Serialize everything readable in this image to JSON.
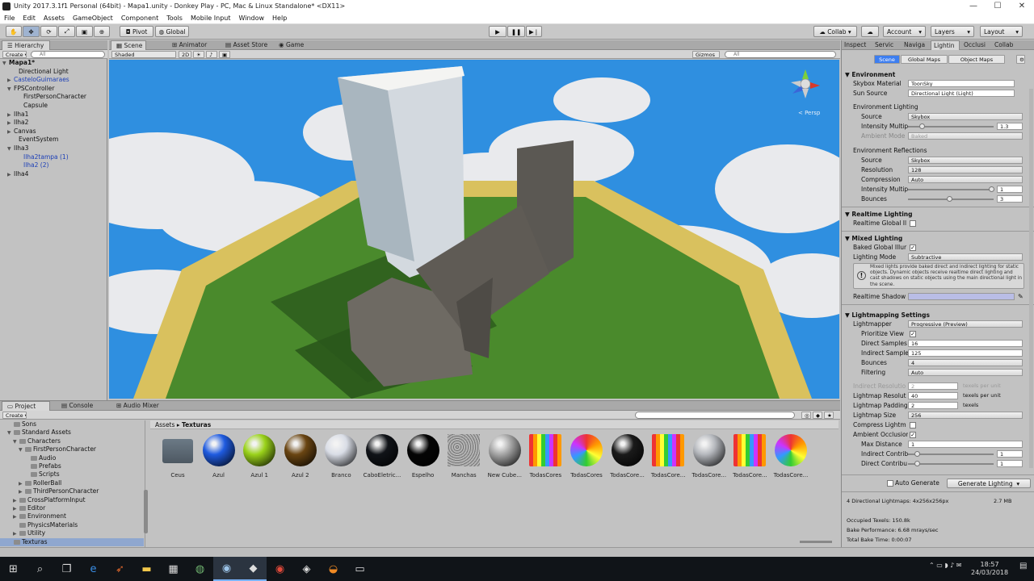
{
  "window": {
    "title": "Unity 2017.3.1f1 Personal (64bit) - Mapa1.unity - Donkey Play - PC, Mac & Linux Standalone* <DX11>",
    "minimize": "—",
    "maximize": "☐",
    "close": "✕"
  },
  "menu": [
    "File",
    "Edit",
    "Assets",
    "GameObject",
    "Component",
    "Tools",
    "Mobile Input",
    "Window",
    "Help"
  ],
  "toolbar": {
    "pivot": "Pivot",
    "global": "Global",
    "collab": "Collab ▾",
    "account": "Account",
    "layers": "Layers",
    "layout": "Layout",
    "play": "▶",
    "pause": "❚❚",
    "step": "▶❘"
  },
  "hierarchy": {
    "tab": "Hierarchy",
    "create": "Create ▾",
    "search_placeholder": "All",
    "rows": [
      {
        "label": "Mapa1*",
        "indent": 0,
        "arrow": "▼",
        "bold": true,
        "blue": false
      },
      {
        "label": "Directional Light",
        "indent": 2,
        "arrow": "",
        "bold": false,
        "blue": false
      },
      {
        "label": "CasteloGuimaraes",
        "indent": 1,
        "arrow": "▶",
        "bold": false,
        "blue": true
      },
      {
        "label": "FPSController",
        "indent": 1,
        "arrow": "▼",
        "bold": false,
        "blue": false
      },
      {
        "label": "FirstPersonCharacter",
        "indent": 3,
        "arrow": "",
        "bold": false,
        "blue": false
      },
      {
        "label": "Capsule",
        "indent": 3,
        "arrow": "",
        "bold": false,
        "blue": false
      },
      {
        "label": "Ilha1",
        "indent": 1,
        "arrow": "▶",
        "bold": false,
        "blue": false
      },
      {
        "label": "Ilha2",
        "indent": 1,
        "arrow": "▶",
        "bold": false,
        "blue": false
      },
      {
        "label": "Canvas",
        "indent": 1,
        "arrow": "▶",
        "bold": false,
        "blue": false
      },
      {
        "label": "EventSystem",
        "indent": 2,
        "arrow": "",
        "bold": false,
        "blue": false
      },
      {
        "label": "Ilha3",
        "indent": 1,
        "arrow": "▼",
        "bold": false,
        "blue": false
      },
      {
        "label": "Ilha2tampa (1)",
        "indent": 3,
        "arrow": "",
        "bold": false,
        "blue": true
      },
      {
        "label": "Ilha2 (2)",
        "indent": 3,
        "arrow": "",
        "bold": false,
        "blue": true
      },
      {
        "label": "Ilha4",
        "indent": 1,
        "arrow": "▶",
        "bold": false,
        "blue": false
      }
    ]
  },
  "scene": {
    "tabs": [
      "Scene",
      "Animator",
      "Asset Store",
      "Game"
    ],
    "shading": "Shaded",
    "mode2d": "2D",
    "gizmos": "Gizmos",
    "search_placeholder": "All",
    "persp": "< Persp"
  },
  "project": {
    "tabs": [
      "Project",
      "Console",
      "Audio Mixer"
    ],
    "create": "Create ▾",
    "breadcrumb": [
      "Assets",
      "Texturas"
    ],
    "tree": [
      {
        "label": "Sons",
        "indent": 1,
        "arrow": ""
      },
      {
        "label": "Standard Assets",
        "indent": 1,
        "arrow": "▼"
      },
      {
        "label": "Characters",
        "indent": 2,
        "arrow": "▼"
      },
      {
        "label": "FirstPersonCharacter",
        "indent": 3,
        "arrow": "▼"
      },
      {
        "label": "Audio",
        "indent": 4,
        "arrow": ""
      },
      {
        "label": "Prefabs",
        "indent": 4,
        "arrow": ""
      },
      {
        "label": "Scripts",
        "indent": 4,
        "arrow": ""
      },
      {
        "label": "RollerBall",
        "indent": 3,
        "arrow": "▶"
      },
      {
        "label": "ThirdPersonCharacter",
        "indent": 3,
        "arrow": "▶"
      },
      {
        "label": "CrossPlatformInput",
        "indent": 2,
        "arrow": "▶"
      },
      {
        "label": "Editor",
        "indent": 2,
        "arrow": "▶"
      },
      {
        "label": "Environment",
        "indent": 2,
        "arrow": "▶"
      },
      {
        "label": "PhysicsMaterials",
        "indent": 2,
        "arrow": ""
      },
      {
        "label": "Utility",
        "indent": 2,
        "arrow": "▶"
      },
      {
        "label": "Texturas",
        "indent": 1,
        "arrow": "",
        "selected": true
      }
    ],
    "assets": [
      {
        "label": "Ceus",
        "kind": "folder",
        "color": "#6c7a86"
      },
      {
        "label": "Azul",
        "kind": "sphere",
        "color": "#1f5be0"
      },
      {
        "label": "Azul 1",
        "kind": "sphere",
        "color": "#9ad21a"
      },
      {
        "label": "Azul 2",
        "kind": "sphere",
        "color": "#6a4512"
      },
      {
        "label": "Branco",
        "kind": "sphere",
        "color": "#d9dde6"
      },
      {
        "label": "CaboEletric...",
        "kind": "sphere",
        "color": "#101318"
      },
      {
        "label": "Espelho",
        "kind": "sphere",
        "color": "#050505"
      },
      {
        "label": "Manchas",
        "kind": "noise",
        "color": "#9a9a9a"
      },
      {
        "label": "New Cube...",
        "kind": "sphere",
        "color": "#a6a6a6"
      },
      {
        "label": "TodasCores",
        "kind": "grid",
        "color": "#e33"
      },
      {
        "label": "TodasCores",
        "kind": "rainbow",
        "color": "#7a8a9a"
      },
      {
        "label": "TodasCore...",
        "kind": "sphere",
        "color": "#1a1a1a"
      },
      {
        "label": "TodasCore...",
        "kind": "grid",
        "color": "#e33"
      },
      {
        "label": "TodasCore...",
        "kind": "sphere",
        "color": "#b5b8bd"
      },
      {
        "label": "TodasCore...",
        "kind": "grid",
        "color": "#e33"
      },
      {
        "label": "TodasCore...",
        "kind": "rainbow",
        "color": "#7a8a9a"
      }
    ]
  },
  "inspector": {
    "tabs": [
      "Inspect",
      "Servic",
      "Naviga",
      "Lightin",
      "Occlusi",
      "Collab"
    ],
    "subtabs": [
      "Scene",
      "Global Maps",
      "Object Maps"
    ],
    "env": {
      "header": "Environment",
      "skybox_k": "Skybox Material",
      "skybox_v": "ToonSky",
      "sun_k": "Sun Source",
      "sun_v": "Directional Light (Light)",
      "lighting_h": "Environment Lighting",
      "source_k": "Source",
      "source_v": "Skybox",
      "intensity_k": "Intensity Multip",
      "intensity_v": "1.3",
      "ambient_k": "Ambient Mode",
      "ambient_v": "Baked",
      "refl_h": "Environment Reflections",
      "rsource_k": "Source",
      "rsource_v": "Skybox",
      "res_k": "Resolution",
      "res_v": "128",
      "comp_k": "Compression",
      "comp_v": "Auto",
      "rint_k": "Intensity Multip",
      "rint_v": "1",
      "bounces_k": "Bounces",
      "bounces_v": "3"
    },
    "realtime": {
      "header": "Realtime Lighting",
      "gi_k": "Realtime Global Il"
    },
    "mixed": {
      "header": "Mixed Lighting",
      "baked_k": "Baked Global Illur",
      "mode_k": "Lighting Mode",
      "mode_v": "Subtractive",
      "info": "Mixed lights provide baked direct and indirect lighting for static objects. Dynamic objects receive realtime direct lighting and cast shadows on static objects using the main directional light in the scene.",
      "shadow_k": "Realtime Shadow"
    },
    "lightmap": {
      "header": "Lightmapping Settings",
      "mapper_k": "Lightmapper",
      "mapper_v": "Progressive (Preview)",
      "prio_k": "Prioritize View",
      "direct_k": "Direct Samples",
      "direct_v": "16",
      "indirect_k": "Indirect Sample",
      "indirect_v": "125",
      "bounces_k": "Bounces",
      "bounces_v": "4",
      "filter_k": "Filtering",
      "filter_v": "Auto",
      "ires_k": "Indirect Resolutio",
      "ires_v": "2",
      "ires_u": "texels per unit",
      "lres_k": "Lightmap Resolut",
      "lres_v": "40",
      "lres_u": "texels per unit",
      "pad_k": "Lightmap Padding",
      "pad_v": "2",
      "pad_u": "texels",
      "size_k": "Lightmap Size",
      "size_v": "256",
      "compress_k": "Compress Lightm",
      "ao_k": "Ambient Occlusior",
      "maxd_k": "Max Distance",
      "maxd_v": "1",
      "ic_k": "Indirect Contrib",
      "ic_v": "1",
      "dc_k": "Direct Contribu",
      "dc_v": "1"
    },
    "auto_generate": "Auto Generate",
    "generate": "Generate Lighting",
    "stats": {
      "lightmaps": "4 Directional Lightmaps: 4x256x256px",
      "size": "2.7 MB",
      "texels": "Occupied Texels: 150.8k",
      "perf": "Bake Performance: 6.68 mrays/sec",
      "time": "Total Bake Time: 0:00:07"
    }
  },
  "taskbar": {
    "time": "18:57",
    "date": "24/03/2018",
    "icons": [
      "windows-start",
      "search",
      "task-view",
      "edge",
      "sublime",
      "file-explorer",
      "calculator",
      "globe",
      "steam",
      "unity",
      "chrome",
      "unity-hub",
      "blender",
      "terminal"
    ]
  },
  "colors": {
    "sky": "#2f8fe0",
    "grass": "#4a8a2c",
    "sand": "#d9c15e",
    "castle": "#6e6a63",
    "tower": "#eeeeea",
    "accent": "#3d7ef0"
  }
}
